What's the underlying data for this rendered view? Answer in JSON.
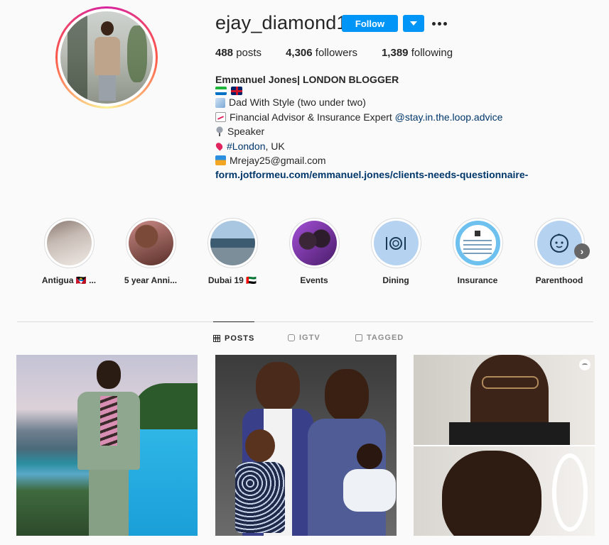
{
  "profile": {
    "username": "ejay_diamond1",
    "follow_label": "Follow",
    "posts_count": "488",
    "posts_label": "posts",
    "followers_count": "4,306",
    "followers_label": "followers",
    "following_count": "1,389",
    "following_label": "following"
  },
  "bio": {
    "name": "Emmanuel Jones| LONDON BLOGGER",
    "line_dad": "Dad With Style (two under two)",
    "line_financial": "Financial Advisor & Insurance Expert ",
    "line_financial_link": "@stay.in.the.loop.advice",
    "line_speaker": "Speaker",
    "line_location_tag": "#London",
    "line_location_rest": ", UK",
    "line_email": "Mrejay25@gmail.com",
    "url": "form.jotformeu.com/emmanuel.jones/clients-needs-questionnaire-"
  },
  "highlights": [
    {
      "label": "Antigua 🇦🇬 ..."
    },
    {
      "label": "5 year Anni..."
    },
    {
      "label": "Dubai 19 🇦🇪"
    },
    {
      "label": "Events"
    },
    {
      "label": "Dining"
    },
    {
      "label": "Insurance"
    },
    {
      "label": "Parenthood"
    }
  ],
  "tabs": {
    "posts": "POSTS",
    "igtv": "IGTV",
    "tagged": "TAGGED"
  },
  "colors": {
    "accent": "#0095f6",
    "link": "#00376b",
    "text": "#262626",
    "muted": "#8e8e8e"
  },
  "icons": {
    "more": "more-options-icon",
    "dropdown": "chevron-down-icon",
    "highlights_next": "chevron-right-icon",
    "posts_tab": "grid-icon",
    "igtv_tab": "igtv-icon",
    "tagged_tab": "tagged-icon",
    "dining": "plate-cutlery-icon",
    "parenthood": "baby-face-icon"
  }
}
